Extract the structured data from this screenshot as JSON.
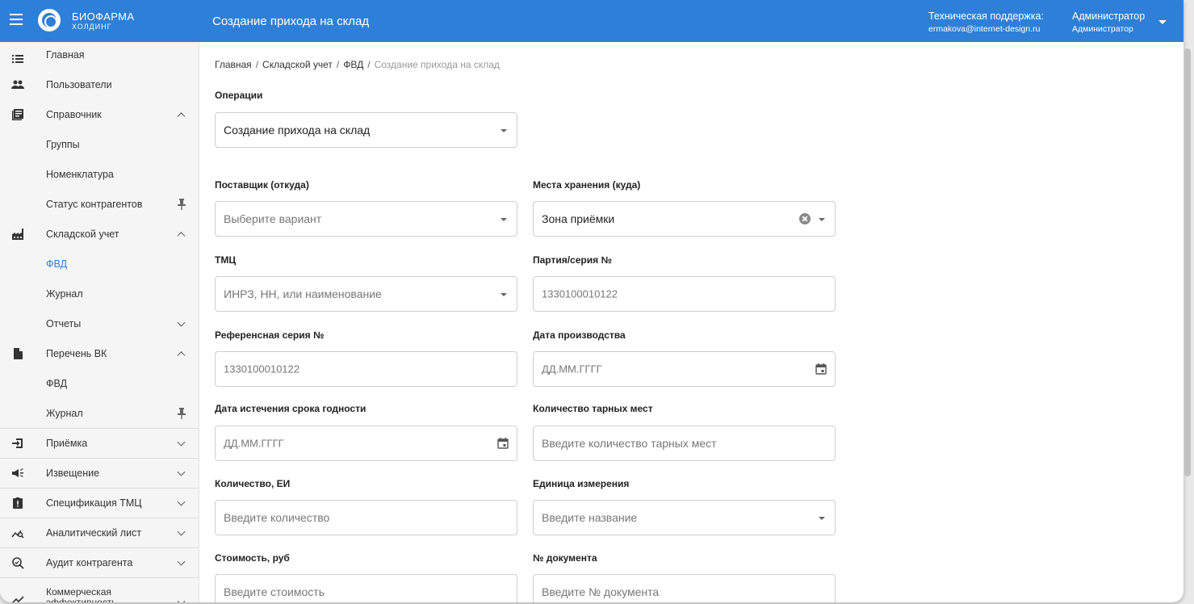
{
  "header": {
    "logo_line1": "БИОФАРМА",
    "logo_line2": "ХОЛДИНГ",
    "page_title": "Создание прихода на склад",
    "support_label": "Техническая поддержка:",
    "support_email": "ermakova@internet-design.ru",
    "user_name": "Администратор",
    "user_role": "Администратор"
  },
  "sidebar": {
    "items": [
      {
        "label": "Главная"
      },
      {
        "label": "Пользователи"
      },
      {
        "label": "Справочник"
      },
      {
        "label": "Группы"
      },
      {
        "label": "Номенклатура"
      },
      {
        "label": "Статус контрагентов"
      },
      {
        "label": "Складской учет"
      },
      {
        "label": "ФВД"
      },
      {
        "label": "Журнал"
      },
      {
        "label": "Отчеты"
      },
      {
        "label": "Перечень ВК"
      },
      {
        "label": "ФВД"
      },
      {
        "label": "Журнал"
      },
      {
        "label": "Приёмка"
      },
      {
        "label": "Извещение"
      },
      {
        "label": "Спецификация ТМЦ"
      },
      {
        "label": "Аналитический лист"
      },
      {
        "label": "Аудит контрагента"
      },
      {
        "label": "Коммерческая эффективность"
      }
    ]
  },
  "breadcrumb": {
    "items": [
      "Главная",
      "Складской учет",
      "ФВД"
    ],
    "current": "Создание прихода на склад"
  },
  "form": {
    "operations_label": "Операции",
    "operations_value": "Создание прихода на склад",
    "supplier_label": "Поставщик (откуда)",
    "supplier_placeholder": "Выберите вариант",
    "storage_label": "Места хранения (куда)",
    "storage_value": "Зона приёмки",
    "tmc_label": "ТМЦ",
    "tmc_placeholder": "ИНРЗ, НН, или наименование",
    "batch_label": "Партия/серия №",
    "batch_placeholder": "1330100010122",
    "ref_series_label": "Референсная серия №",
    "ref_series_placeholder": "1330100010122",
    "prod_date_label": "Дата производства",
    "prod_date_placeholder": "ДД.ММ.ГГГГ",
    "expiry_label": "Дата истечения срока годности",
    "expiry_placeholder": "ДД.ММ.ГГГГ",
    "packages_label": "Количество тарных мест",
    "packages_placeholder": "Введите количество тарных мест",
    "quantity_label": "Количество, ЕИ",
    "quantity_placeholder": "Введите количество",
    "unit_label": "Единица измерения",
    "unit_placeholder": "Введите название",
    "cost_label": "Стоимость, руб",
    "cost_placeholder": "Введите стоимость",
    "docnum_label": "№ документа",
    "docnum_placeholder": "Введите № документа"
  },
  "colors": {
    "header_bg": "#2e7fd7",
    "active_nav": "#2e7fd7"
  }
}
